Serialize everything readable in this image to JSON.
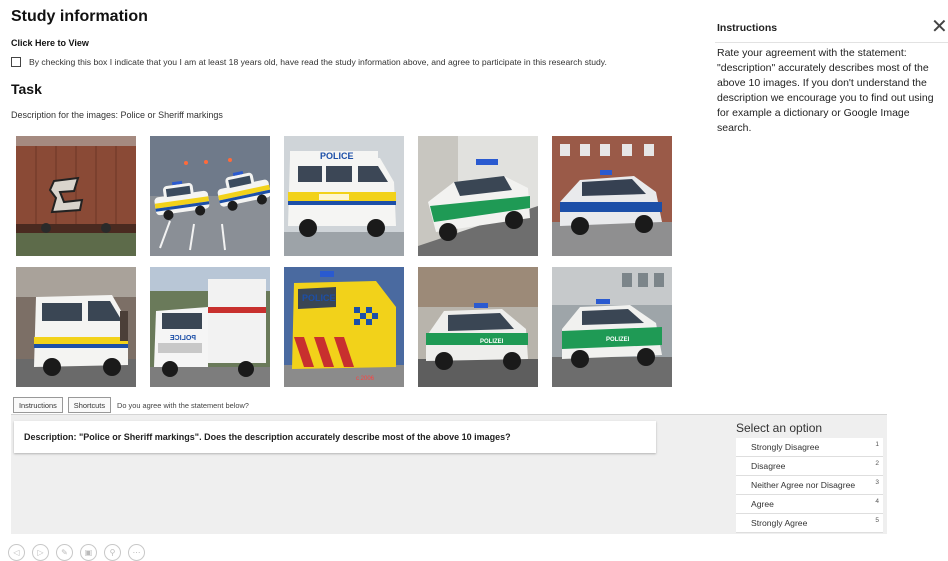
{
  "study": {
    "title": "Study information",
    "click_here": "Click Here to View",
    "consent": "By checking this box I indicate that you I am at least 18 years old, have read the study information above, and agree to participate in this research study.",
    "consent_checked": false
  },
  "task": {
    "title": "Task",
    "description_line": "Description for the images: Police or Sheriff markings"
  },
  "images": [
    {
      "name": "image-train-graffiti"
    },
    {
      "name": "image-police-cars-pair"
    },
    {
      "name": "image-police-van-white"
    },
    {
      "name": "image-polizei-car-green"
    },
    {
      "name": "image-polizei-car-blue"
    },
    {
      "name": "image-police-van-street"
    },
    {
      "name": "image-ambulance-truck"
    },
    {
      "name": "image-police-van-yellow"
    },
    {
      "name": "image-polizei-car-green-2"
    },
    {
      "name": "image-polizei-car-green-3"
    }
  ],
  "image_labels": {
    "police": "POLICE",
    "police_mirror": "POLICE",
    "polizei": "POLIZEI",
    "watermark": "c 2006"
  },
  "buttons": {
    "instructions": "Instructions",
    "shortcuts": "Shortcuts"
  },
  "question": "Do you agree with the statement below?",
  "statement": "Description: \"Police or Sheriff markings\". Does the description accurately describe most of the above 10 images?",
  "select": {
    "title": "Select an option",
    "options": [
      {
        "label": "Strongly Disagree",
        "key": "1"
      },
      {
        "label": "Disagree",
        "key": "2"
      },
      {
        "label": "Neither Agree nor Disagree",
        "key": "3"
      },
      {
        "label": "Agree",
        "key": "4"
      },
      {
        "label": "Strongly Agree",
        "key": "5"
      }
    ]
  },
  "toolbar": [
    {
      "icon": "back-icon",
      "glyph": "◁"
    },
    {
      "icon": "forward-icon",
      "glyph": "▷"
    },
    {
      "icon": "pen-icon",
      "glyph": "✎"
    },
    {
      "icon": "save-icon",
      "glyph": "▣"
    },
    {
      "icon": "zoom-icon",
      "glyph": "⚲"
    },
    {
      "icon": "more-icon",
      "glyph": "⋯"
    }
  ],
  "instructions": {
    "title": "Instructions",
    "close_glyph": "✕",
    "body": "Rate your agreement with the statement: \"description\" accurately describes most of the above 10 images. If you don't understand the description we encourage you to find out using for example a dictionary or Google Image search."
  },
  "colors": {
    "panel_bg": "#efefef",
    "polizei_green": "#1f9a55",
    "police_yellow": "#f2d21a",
    "police_blue": "#1c4fa8"
  }
}
